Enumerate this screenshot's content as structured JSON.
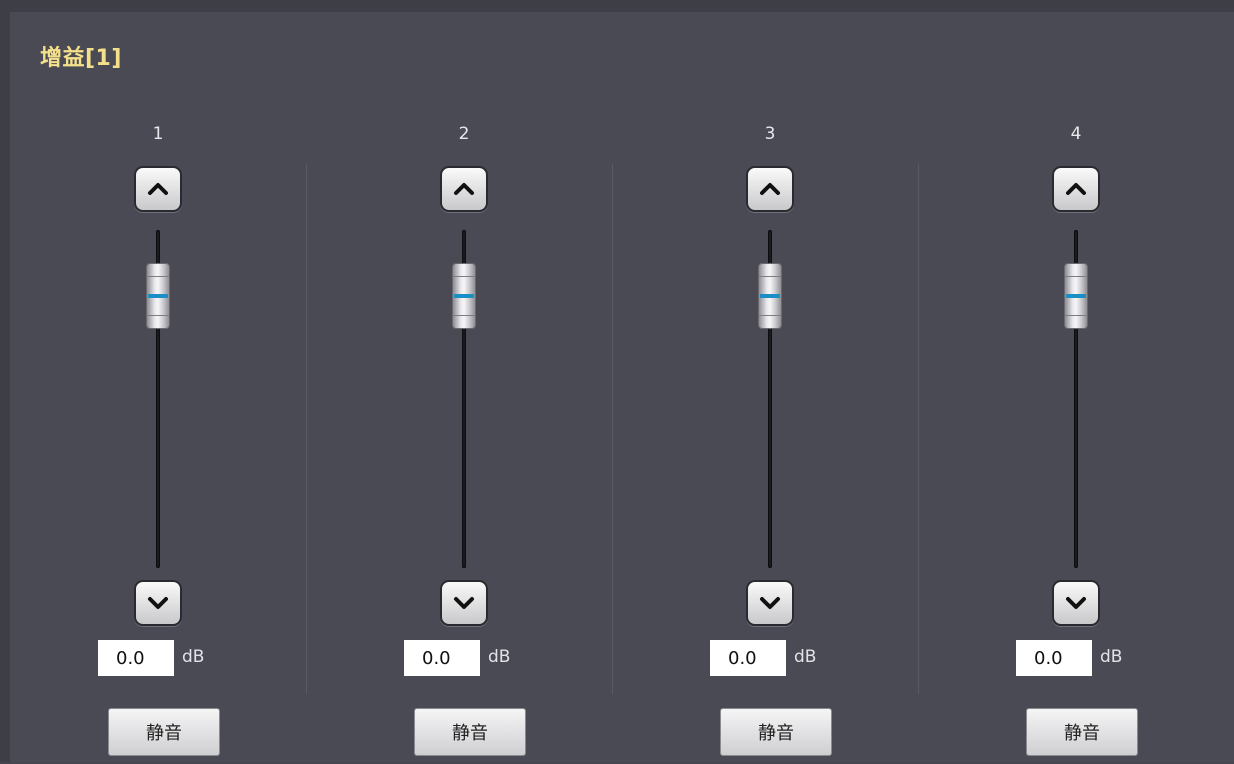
{
  "panel": {
    "title": "增益[1]"
  },
  "channels": [
    {
      "label": "1",
      "value": "0.0",
      "unit": "dB",
      "mute_label": "静音",
      "level_fraction": 0.88
    },
    {
      "label": "2",
      "value": "0.0",
      "unit": "dB",
      "mute_label": "静音",
      "level_fraction": 0.88
    },
    {
      "label": "3",
      "value": "0.0",
      "unit": "dB",
      "mute_label": "静音",
      "level_fraction": 0.88
    },
    {
      "label": "4",
      "value": "0.0",
      "unit": "dB",
      "mute_label": "静音",
      "level_fraction": 0.88
    }
  ],
  "icons": {
    "up": "chevron-up-icon",
    "down": "chevron-down-icon"
  },
  "colors": {
    "title": "#f4e08a",
    "thumb_indicator": "#1a8fc4",
    "background": "#4a4a54"
  }
}
